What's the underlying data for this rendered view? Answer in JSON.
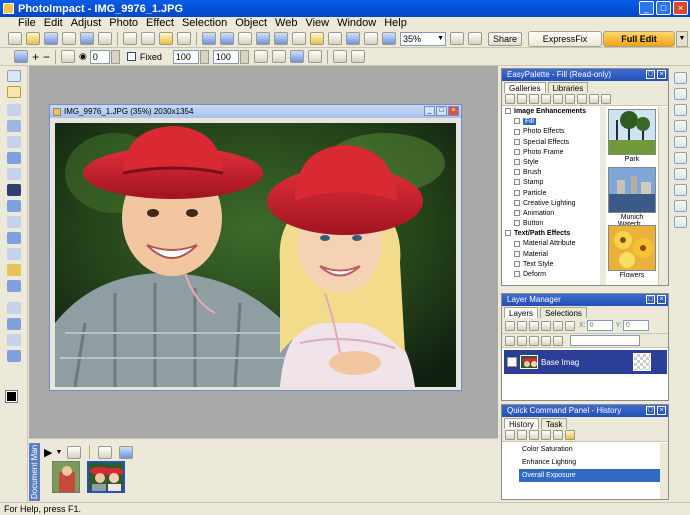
{
  "window": {
    "title": "PhotoImpact - IMG_9976_1.JPG",
    "controls": [
      "_",
      "□",
      "×"
    ]
  },
  "menu": [
    "File",
    "Edit",
    "Adjust",
    "Photo",
    "Effect",
    "Selection",
    "Object",
    "Web",
    "View",
    "Window",
    "Help"
  ],
  "toolbar": {
    "zoom": "35%",
    "share_label": "Share",
    "expressfix_label": "ExpressFix",
    "fulledit_label": "Full Edit"
  },
  "attribute_bar": {
    "brush_size": "0",
    "fixed_label": "Fixed",
    "width": "100",
    "height": "100"
  },
  "document": {
    "title": "IMG_9976_1.JPG (35%) 2030x1354"
  },
  "filmstrip": {
    "label": "Document Man"
  },
  "status": "For Help, press F1.",
  "easypalette": {
    "title": "EasyPalette - Fill (Read-only)",
    "tabs": [
      "Galleries",
      "Libraries"
    ],
    "tree": [
      {
        "label": "Image Enhancements",
        "group": true
      },
      {
        "label": "Fill",
        "selected": true
      },
      {
        "label": "Photo Effects"
      },
      {
        "label": "Special Effects"
      },
      {
        "label": "Photo Frame"
      },
      {
        "label": "Style"
      },
      {
        "label": "Brush"
      },
      {
        "label": "Stamp"
      },
      {
        "label": "Particle"
      },
      {
        "label": "Creative Lighting"
      },
      {
        "label": "Animation"
      },
      {
        "label": "Button"
      },
      {
        "label": "Text/Path Effects",
        "group": true
      },
      {
        "label": "Material Attribute"
      },
      {
        "label": "Material"
      },
      {
        "label": "Text Style"
      },
      {
        "label": "Deform"
      }
    ],
    "thumbs": [
      "Park",
      "Munich Waterfr...",
      "Flowers"
    ]
  },
  "layer_manager": {
    "title": "Layer Manager",
    "tabs": [
      "Layers",
      "Selections"
    ],
    "x_label": "X:",
    "y_label": "Y:",
    "x_value": "0",
    "y_value": "0",
    "layer_name": "Base Imag"
  },
  "history": {
    "title": "Quick Command Panel - History",
    "tabs": [
      "History",
      "Task"
    ],
    "items": [
      "Color Saturation",
      "Enhance Lighting",
      "Overall Exposure"
    ],
    "selected_index": 2
  },
  "colors": {
    "titlebar": "#0a5de6",
    "workspace": "#a8a8a8",
    "panel_title": "#3d6bd0",
    "layer_selected": "#2b3f97",
    "selection": "#316ac5",
    "fulledit_accent": "#f0a218"
  }
}
